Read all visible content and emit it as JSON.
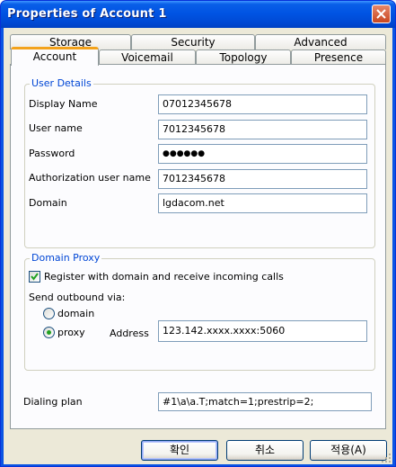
{
  "window": {
    "title": "Properties of Account 1"
  },
  "tabs_back": [
    "Storage",
    "Security",
    "Advanced"
  ],
  "tabs_front": [
    "Account",
    "Voicemail",
    "Topology",
    "Presence"
  ],
  "user_details": {
    "title": "User Details",
    "display_name_label": "Display Name",
    "display_name_value": "07012345678",
    "user_name_label": "User name",
    "user_name_value": "7012345678",
    "password_label": "Password",
    "password_value": "●●●●●●",
    "auth_user_label": "Authorization user name",
    "auth_user_value": "7012345678",
    "domain_label": "Domain",
    "domain_value": "lgdacom.net"
  },
  "domain_proxy": {
    "title": "Domain Proxy",
    "register_label": "Register with domain and receive incoming calls",
    "register_checked": true,
    "send_via_label": "Send outbound via:",
    "domain_option": "domain",
    "proxy_option": "proxy",
    "selected": "proxy",
    "address_label": "Address",
    "address_value": "123.142.xxxx.xxxx:5060"
  },
  "dialing_plan": {
    "label": "Dialing plan",
    "value": "#1\\a\\a.T;match=1;prestrip=2;"
  },
  "buttons": {
    "ok": "확인",
    "cancel": "취소",
    "apply": "적용(A)"
  },
  "colors": {
    "title_bar": "#0054e3",
    "dialog_bg": "#ece9d8",
    "group_title": "#0046d5",
    "active_tab_accent": "#f3a21b"
  }
}
